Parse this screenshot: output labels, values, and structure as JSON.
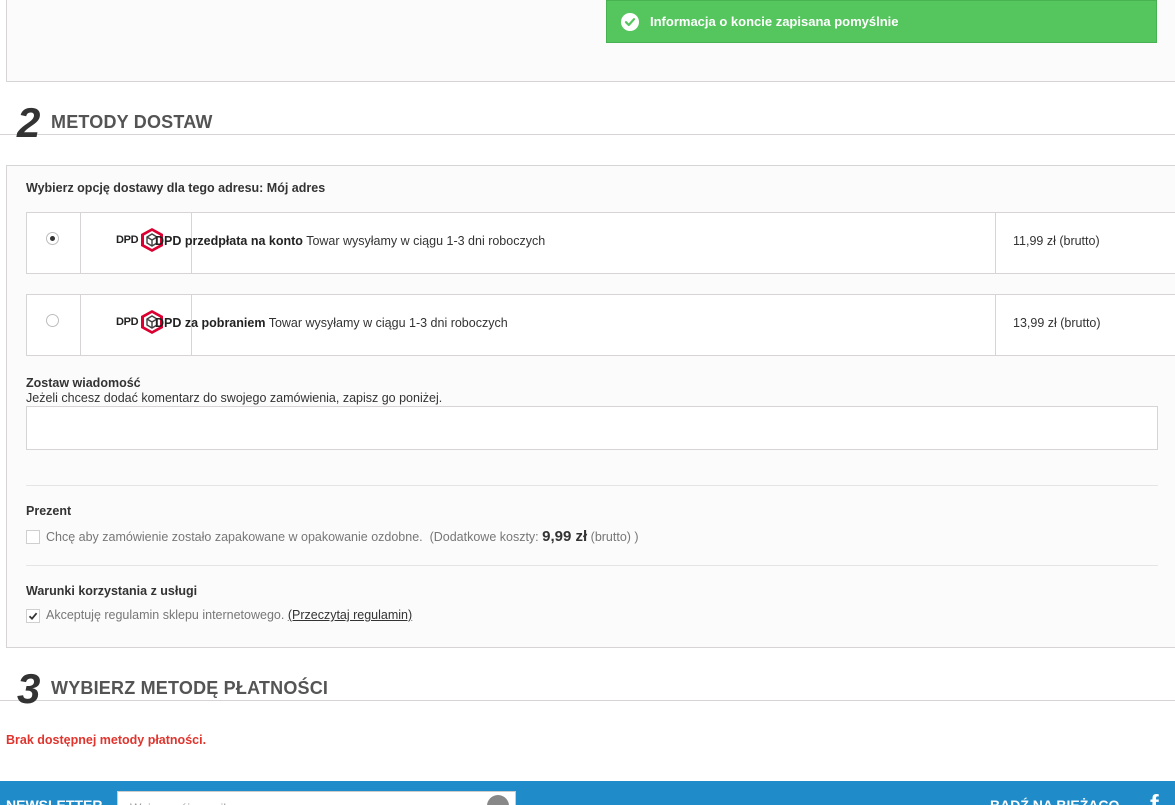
{
  "alert": {
    "message": "Informacja o koncie zapisana pomyślnie",
    "color": "#55c65e"
  },
  "steps": [
    {
      "number": "2",
      "title": "METODY DOSTAW"
    },
    {
      "number": "3",
      "title": "WYBIERZ METODĘ PŁATNOŚCI"
    }
  ],
  "delivery": {
    "address_prompt": "Wybierz opcję dostawy dla tego adresu: Mój adres",
    "carriers": [
      {
        "logo_text": "DPD",
        "logo_icon": "dpd-box-icon",
        "name": "DPD przedpłata na konto",
        "description": "Towar wysyłamy w ciągu 1-3 dni roboczych",
        "price": "11,99 zł (brutto)",
        "selected": true
      },
      {
        "logo_text": "DPD",
        "logo_icon": "dpd-box-icon",
        "name": "DPD za pobraniem",
        "description": "Towar wysyłamy w ciągu 1-3 dni roboczych",
        "price": "13,99 zł (brutto)",
        "selected": false
      }
    ]
  },
  "message": {
    "heading": "Zostaw wiadomość",
    "hint": "Jeżeli chcesz dodać komentarz do swojego zamówienia, zapisz go poniżej.",
    "value": ""
  },
  "gift": {
    "heading": "Prezent",
    "label": "Chcę aby zamówienie zostało zapakowane w opakowanie ozdobne.",
    "cost_prefix": "(Dodatkowe koszty:",
    "cost_amount": "9,99 zł",
    "cost_suffix": "(brutto) )",
    "checked": false
  },
  "terms": {
    "heading": "Warunki korzystania z usługi",
    "label": "Akceptuję regulamin sklepu internetowego.",
    "link": "(Przeczytaj regulamin)",
    "checked": true
  },
  "payment": {
    "error": "Brak dostępnej metody płatności."
  },
  "footer": {
    "newsletter_label": "NEWSLETTER",
    "newsletter_placeholder": "Wpisz swój e-mail",
    "stay_label": "BADŹ NA BIEŻĄCO",
    "social_icon": "facebook-icon"
  }
}
